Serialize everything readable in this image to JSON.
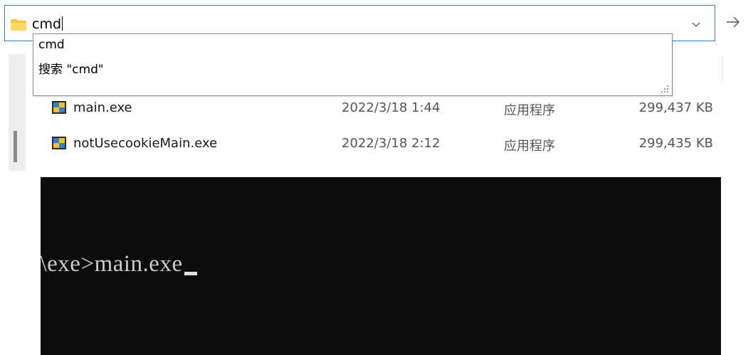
{
  "address_bar": {
    "value": "cmd",
    "folder_icon": "folder-icon",
    "dropdown_icon": "chevron-down-icon",
    "go_icon": "arrow-right-icon"
  },
  "autocomplete": {
    "items": [
      {
        "label": "cmd"
      },
      {
        "label": "搜索 \"cmd\""
      }
    ]
  },
  "files": [
    {
      "name": "main.exe",
      "date": "2022/3/18 1:44",
      "type": "应用程序",
      "size": "299,437 KB",
      "icon": "exe-icon"
    },
    {
      "name": "notUsecookieMain.exe",
      "date": "2022/3/18 2:12",
      "type": "应用程序",
      "size": "299,435 KB",
      "icon": "exe-icon"
    }
  ],
  "console": {
    "line": ")\\exe>main.exe",
    "background": "#0c0c0c",
    "text_color": "#cccccc"
  },
  "colors": {
    "accent": "#2d7fd3",
    "folder": "#f4c542"
  }
}
